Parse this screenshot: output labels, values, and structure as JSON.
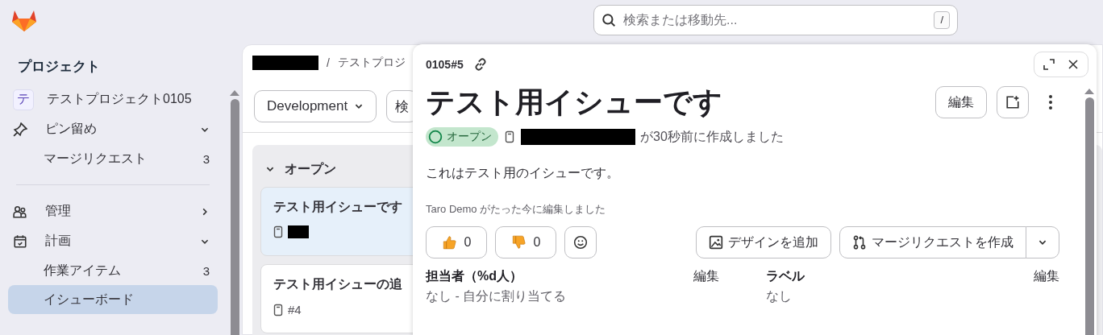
{
  "search": {
    "placeholder": "検索または移動先...",
    "shortcut": "/"
  },
  "sidebar": {
    "heading": "プロジェクト",
    "project": {
      "avatar": "テ",
      "name": "テストプロジェクト0105"
    },
    "sections": [
      {
        "label": "ピン留め",
        "kind": "pin",
        "expanded": true,
        "items": [
          {
            "label": "マージリクエスト",
            "count": "3",
            "selected": false
          }
        ]
      },
      {
        "label": "管理",
        "kind": "people",
        "expanded": false
      },
      {
        "label": "計画",
        "kind": "calendar",
        "expanded": true,
        "items": [
          {
            "label": "作業アイテム",
            "count": "3",
            "selected": false
          },
          {
            "label": "イシューボード",
            "selected": true
          }
        ]
      }
    ]
  },
  "main": {
    "breadcrumb_separator": "/",
    "breadcrumb": "テストプロジ",
    "filters": [
      {
        "label": "Development",
        "dropdown": true
      },
      {
        "label": "検",
        "dropdown": false
      }
    ],
    "column": {
      "title": "オープン",
      "expanded": true,
      "cards": [
        {
          "title": "テスト用イシューです",
          "selected": true
        },
        {
          "title": "テスト用イシューの追",
          "ref": "#4",
          "selected": false
        }
      ]
    }
  },
  "drawer": {
    "ref": "0105#5",
    "title": "テスト用イシューです",
    "edit": "編集",
    "status": {
      "label": "オープン",
      "kind": "open"
    },
    "created": "が30秒前に作成しました",
    "description": "これはテスト用のイシューです。",
    "edited": "Taro Demo がたった今に編集しました",
    "reactions": [
      {
        "kind": "thumbs-up",
        "count": "0"
      },
      {
        "kind": "thumbs-down",
        "count": "0"
      }
    ],
    "design_button": "デザインを追加",
    "mr_button": "マージリクエストを作成",
    "attributes": [
      {
        "label": "担当者（%d人）",
        "value": "なし - 自分に割り当てる",
        "edit": "編集"
      },
      {
        "label": "ラベル",
        "value": "なし",
        "edit": "編集"
      }
    ]
  }
}
